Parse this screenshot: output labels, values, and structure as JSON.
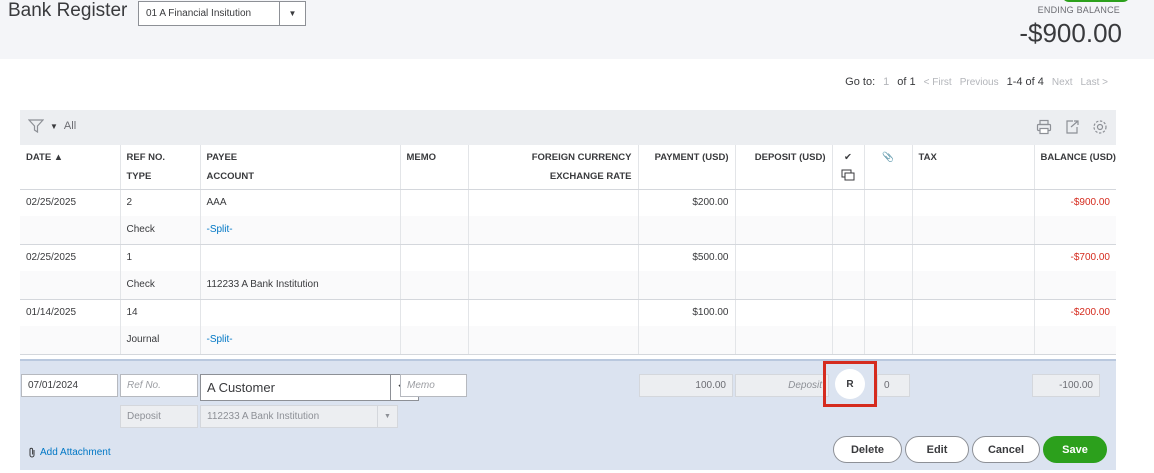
{
  "header": {
    "title": "Bank Register",
    "account_selected": "01 A Financial Insitution",
    "ending_balance_label": "ENDING BALANCE",
    "ending_balance_value": "-$900.00"
  },
  "pager": {
    "goto_label": "Go to:",
    "page_input": "1",
    "of_label": "of 1",
    "first": "< First",
    "previous": "Previous",
    "range": "1-4 of 4",
    "next": "Next",
    "last": "Last >"
  },
  "toolbar": {
    "filter_label": "All"
  },
  "columns": {
    "date": "DATE ▲",
    "ref_no": "REF NO.",
    "type": "TYPE",
    "payee": "PAYEE",
    "account": "ACCOUNT",
    "memo": "MEMO",
    "foreign_currency": "FOREIGN CURRENCY",
    "exchange_rate": "EXCHANGE RATE",
    "payment": "PAYMENT (USD)",
    "deposit": "DEPOSIT (USD)",
    "check_mark": "✔",
    "tax": "TAX",
    "balance": "BALANCE (USD)"
  },
  "rows": [
    {
      "date": "02/25/2025",
      "ref_no": "2",
      "type": "Check",
      "payee": "AAA",
      "account": "-Split-",
      "memo": "",
      "payment": "$200.00",
      "deposit": "",
      "balance": "-$900.00"
    },
    {
      "date": "02/25/2025",
      "ref_no": "1",
      "type": "Check",
      "payee": "",
      "account": "112233 A Bank Institution",
      "memo": "",
      "payment": "$500.00",
      "deposit": "",
      "balance": "-$700.00"
    },
    {
      "date": "01/14/2025",
      "ref_no": "14",
      "type": "Journal",
      "payee": "",
      "account": "-Split-",
      "memo": "",
      "payment": "$100.00",
      "deposit": "",
      "balance": "-$200.00"
    }
  ],
  "edit_row": {
    "date": "07/01/2024",
    "ref_no_placeholder": "Ref No.",
    "payee": "A Customer",
    "memo_placeholder": "Memo",
    "payment": "100.00",
    "deposit_placeholder": "Deposit",
    "reconcile_status": "R",
    "tax": "0",
    "balance": "-100.00",
    "type": "Deposit",
    "account": "112233 A Bank Institution",
    "add_attachment": "Add Attachment",
    "delete": "Delete",
    "edit": "Edit",
    "cancel": "Cancel",
    "save": "Save"
  }
}
